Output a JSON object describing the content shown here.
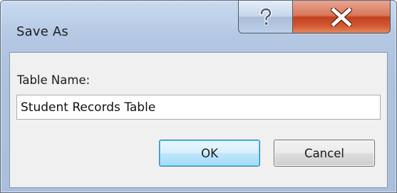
{
  "window": {
    "title": "Save As"
  },
  "caption": {
    "help_icon": "question-mark-icon",
    "close_icon": "close-x-icon"
  },
  "form": {
    "label": "Table Name:",
    "value": "Student Records Table"
  },
  "buttons": {
    "ok_label": "OK",
    "cancel_label": "Cancel"
  },
  "colors": {
    "close_button": "#c7502b",
    "default_button_border": "#3c7fb1",
    "frame": "#b4c8e4"
  }
}
